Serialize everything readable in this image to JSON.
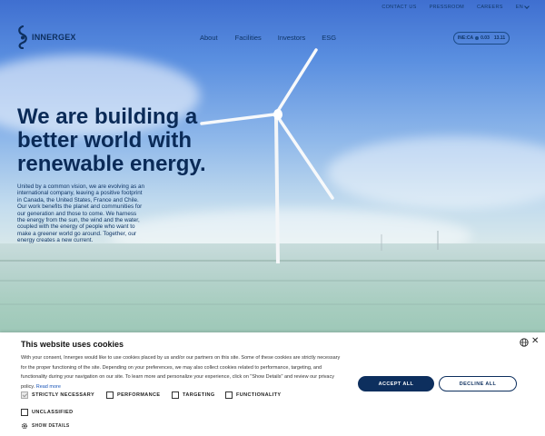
{
  "utility_nav": {
    "contact": "CONTACT US",
    "pressroom": "PRESSROOM",
    "careers": "CAREERS",
    "language": "EN"
  },
  "brand": {
    "name": "INNERGEX"
  },
  "main_nav": [
    "About",
    "Facilities",
    "Investors",
    "ESG"
  ],
  "stock": {
    "ticker": "INE:CA",
    "change": "0.03",
    "price": "13.11"
  },
  "hero": {
    "headline": "We are building a better world with renewable energy.",
    "lede": "United by a common vision, we are evolving as an international company, leaving a positive footprint in Canada, the United States, France and Chile. Our work benefits the planet and communities for our generation and those to come. We harness the energy from the sun, the wind and the water, coupled with the energy of people who want to make a greener world go around. Together, our energy creates a new current."
  },
  "cookie": {
    "title": "This website uses cookies",
    "body": "With your consent, Innergex would like to use cookies placed by us and/or our partners on this site. Some of these cookies are strictly necessary for the proper functioning of the site. Depending on your preferences, we may also collect cookies related to performance, targeting, and functionality during your navigation on our site. To learn more and personalize your experience, click on \"Show Details\" and review our privacy policy.",
    "read_more": "Read more",
    "accept_label": "ACCEPT ALL",
    "decline_label": "DECLINE ALL",
    "show_details": "SHOW DETAILS",
    "options": [
      {
        "label": "STRICTLY NECESSARY",
        "checked": true
      },
      {
        "label": "PERFORMANCE",
        "checked": false
      },
      {
        "label": "TARGETING",
        "checked": false
      },
      {
        "label": "FUNCTIONALITY",
        "checked": false
      },
      {
        "label": "UNCLASSIFIED",
        "checked": false
      }
    ]
  },
  "colors": {
    "brand_navy": "#0d2f5e",
    "link_blue": "#1a56b8",
    "sky_top": "#3f6fd0"
  }
}
